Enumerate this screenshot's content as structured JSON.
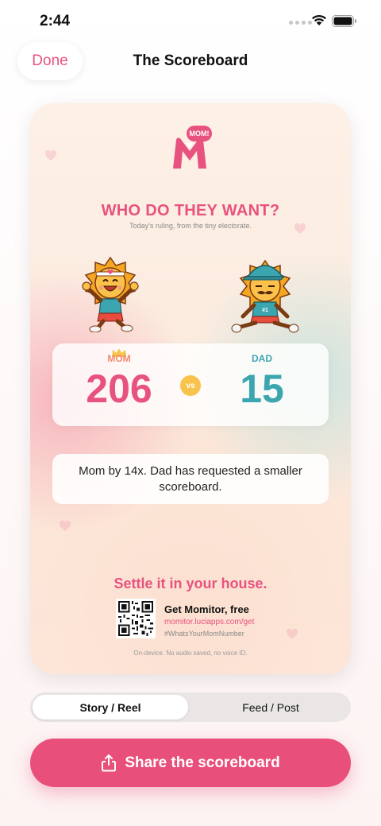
{
  "status_bar": {
    "time": "2:44"
  },
  "nav": {
    "done_label": "Done",
    "title": "The Scoreboard"
  },
  "card": {
    "logo_badge": "MOM!",
    "logo_letter": "M",
    "headline": "WHO DO THEY WANT?",
    "subhead": "Today's ruling, from the tiny electorate.",
    "mom": {
      "label": "MOM",
      "score": "206",
      "leader_icon": "crown-icon"
    },
    "vs_label": "vs",
    "dad": {
      "label": "DAD",
      "score": "15"
    },
    "verdict": "Mom by 14x. Dad has requested a smaller scoreboard.",
    "cta": "Settle it in your house.",
    "promo": {
      "title": "Get Momitor, free",
      "url": "momitor.luciapps.com/get",
      "hashtag": "#WhatsYourMomNumber"
    },
    "privacy": "On-device. No audio saved, no voice ID."
  },
  "format_selector": {
    "options": [
      "Story / Reel",
      "Feed / Post"
    ],
    "selected": "Story / Reel"
  },
  "share": {
    "label": "Share the scoreboard",
    "icon": "share-icon"
  },
  "colors": {
    "accent": "#e8527f",
    "dad": "#3ba6b0",
    "vs": "#f7c34a"
  }
}
